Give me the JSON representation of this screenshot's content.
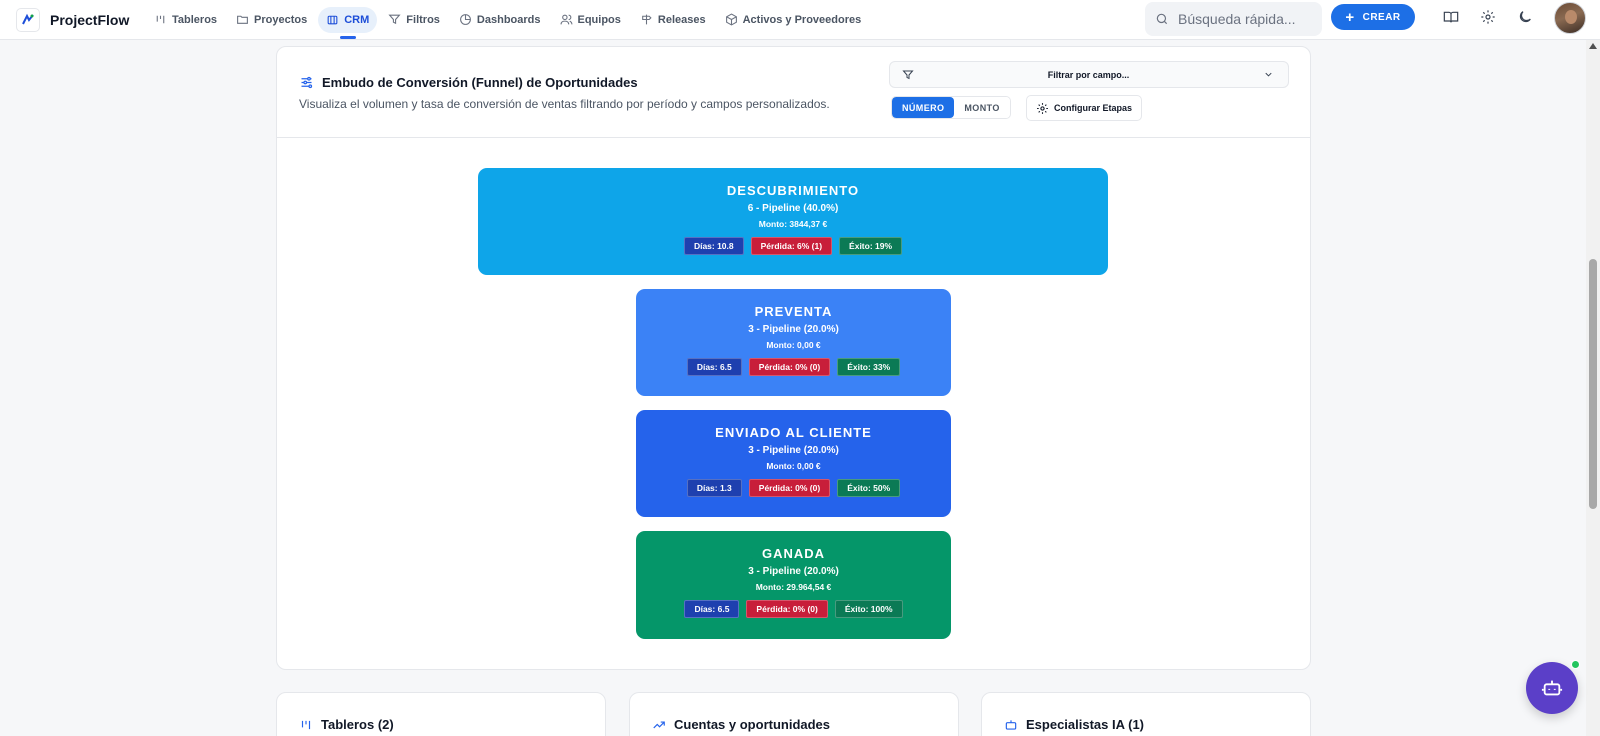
{
  "app": {
    "name": "ProjectFlow"
  },
  "nav": {
    "items": [
      {
        "label": "Tableros",
        "icon": "kanban-icon",
        "active": false
      },
      {
        "label": "Proyectos",
        "icon": "folder-icon",
        "active": false
      },
      {
        "label": "CRM",
        "icon": "building-icon",
        "active": true
      },
      {
        "label": "Filtros",
        "icon": "filter-icon",
        "active": false
      },
      {
        "label": "Dashboards",
        "icon": "pie-chart-icon",
        "active": false
      },
      {
        "label": "Equipos",
        "icon": "users-icon",
        "active": false
      },
      {
        "label": "Releases",
        "icon": "signpost-icon",
        "active": false
      },
      {
        "label": "Activos y Proveedores",
        "icon": "box-icon",
        "active": false
      }
    ]
  },
  "search": {
    "placeholder": "Búsqueda rápida..."
  },
  "create_button": {
    "label": "CREAR"
  },
  "funnel_card": {
    "title": "Embudo de Conversión (Funnel) de Oportunidades",
    "subtitle": "Visualiza el volumen y tasa de conversión de ventas filtrando por período y campos personalizados.",
    "filter_placeholder": "Filtrar por campo...",
    "toggle": {
      "number_label": "NÚMERO",
      "amount_label": "MONTO",
      "selected": "NÚMERO"
    },
    "config_button": "Configurar Etapas"
  },
  "stages": [
    {
      "name": "DESCUBRIMIENTO",
      "pipeline": "6 - Pipeline (40.0%)",
      "amount": "Monto: 3844,37 €",
      "days": "Días: 10.8",
      "loss": "Pérdida: 6% (1)",
      "success": "Éxito: 19%",
      "color": "#0ea5e9"
    },
    {
      "name": "PREVENTA",
      "pipeline": "3 - Pipeline (20.0%)",
      "amount": "Monto: 0,00 €",
      "days": "Días: 6.5",
      "loss": "Pérdida: 0% (0)",
      "success": "Éxito: 33%",
      "color": "#3b82f6"
    },
    {
      "name": "ENVIADO AL CLIENTE",
      "pipeline": "3 - Pipeline (20.0%)",
      "amount": "Monto: 0,00 €",
      "days": "Días: 1.3",
      "loss": "Pérdida: 0% (0)",
      "success": "Éxito: 50%",
      "color": "#2563eb"
    },
    {
      "name": "GANADA",
      "pipeline": "3 - Pipeline (20.0%)",
      "amount": "Monto: 29.964,54 €",
      "days": "Días: 6.5",
      "loss": "Pérdida: 0% (0)",
      "success": "Éxito: 100%",
      "color": "#059669"
    }
  ],
  "bottom_cards": [
    {
      "title": "Tableros (2)",
      "icon": "kanban-icon"
    },
    {
      "title": "Cuentas y oportunidades",
      "icon": "trending-up-icon"
    },
    {
      "title": "Especialistas IA (1)",
      "icon": "bot-icon"
    }
  ],
  "colors": {
    "accent": "#1d6fe6",
    "days_badge": "#1e40af",
    "loss_badge": "#c81e3a",
    "success_badge": "#0b7a55",
    "fab": "#5b3fc8"
  }
}
